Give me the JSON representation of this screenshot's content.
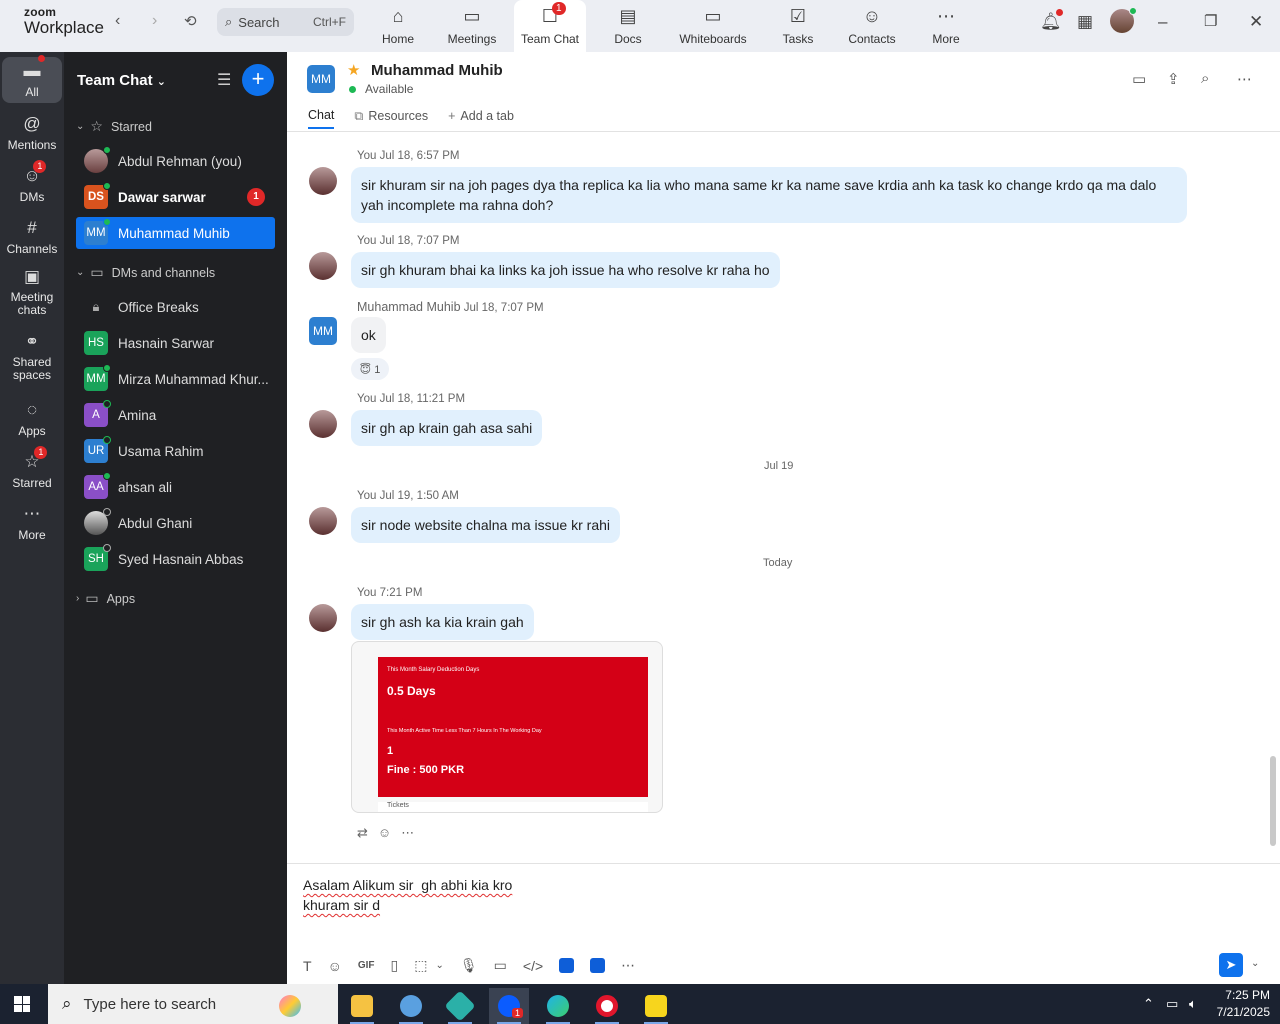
{
  "app": {
    "logo_line1": "zoom",
    "logo_line2": "Workplace"
  },
  "search": {
    "label": "Search",
    "shortcut": "Ctrl+F"
  },
  "nav": [
    {
      "label": "Home",
      "icon": "home-icon"
    },
    {
      "label": "Meetings",
      "icon": "video-icon"
    },
    {
      "label": "Team Chat",
      "icon": "chat-icon",
      "badge": "1",
      "active": true
    },
    {
      "label": "Docs",
      "icon": "doc-icon"
    },
    {
      "label": "Whiteboards",
      "icon": "whiteboard-icon"
    },
    {
      "label": "Tasks",
      "icon": "tasks-icon"
    },
    {
      "label": "Contacts",
      "icon": "contacts-icon"
    },
    {
      "label": "More",
      "icon": "more-icon"
    }
  ],
  "rail": [
    {
      "label": "All",
      "icon": "chat-bubble-icon",
      "active": true
    },
    {
      "label": "Mentions",
      "icon": "at-icon"
    },
    {
      "label": "DMs",
      "icon": "people-icon",
      "badge": "1"
    },
    {
      "label": "Channels",
      "icon": "hash-icon"
    },
    {
      "label": "Meeting chats",
      "icon": "calendar-icon"
    },
    {
      "label": "Shared spaces",
      "icon": "share-icon"
    },
    {
      "label": "Apps",
      "icon": "apps-icon"
    },
    {
      "label": "Starred",
      "icon": "star-icon",
      "badge": "1"
    },
    {
      "label": "More",
      "icon": "more-icon"
    }
  ],
  "sidebar": {
    "title": "Team Chat",
    "starred_label": "Starred",
    "dms_label": "DMs and channels",
    "apps_label": "Apps",
    "starred": [
      {
        "name": "Abdul Rehman (you)",
        "initials": "",
        "color": "photo"
      },
      {
        "name": "Dawar sarwar",
        "initials": "DS",
        "color": "#d9531e",
        "badge": "1",
        "bold": true
      },
      {
        "name": "Muhammad Muhib",
        "initials": "MM",
        "color": "#2d7fd0",
        "selected": true
      }
    ],
    "dms": [
      {
        "name": "Office Breaks",
        "initials": "",
        "color": "lock"
      },
      {
        "name": "Hasnain Sarwar",
        "initials": "HS",
        "color": "#1aa35a"
      },
      {
        "name": "Mirza Muhammad Khur...",
        "initials": "MM",
        "color": "#1aa35a"
      },
      {
        "name": "Amina",
        "initials": "A",
        "color": "#8a4fc7"
      },
      {
        "name": "Usama Rahim",
        "initials": "UR",
        "color": "#2d7fd0"
      },
      {
        "name": "ahsan ali",
        "initials": "AA",
        "color": "#8a4fc7"
      },
      {
        "name": "Abdul Ghani",
        "initials": "",
        "color": "photo2"
      },
      {
        "name": "Syed Hasnain Abbas",
        "initials": "SH",
        "color": "#1aa35a"
      }
    ]
  },
  "chat": {
    "contact_initials": "MM",
    "contact_name": "Muhammad Muhib",
    "status": "Available",
    "tabs": {
      "chat": "Chat",
      "resources": "Resources",
      "add": "Add a tab"
    }
  },
  "messages": {
    "m1_meta": "You Jul 18, 6:57 PM",
    "m1_text": "sir  khuram sir na joh pages dya tha  replica ka lia who mana same kr ka name save krdia anh ka task ko change krdo qa ma dalo yah incomplete ma rahna doh?",
    "m2_meta": "You Jul 18, 7:07 PM",
    "m2_text": "sir gh khuram bhai ka links ka joh issue ha who resolve kr raha ho",
    "m3_name": "Muhammad Muhib",
    "m3_time": "Jul 18, 7:07 PM",
    "m3_text": "ok",
    "m3_reaction": "😇 1",
    "m4_meta": "You Jul 18, 11:21 PM",
    "m4_text": "sir gh ap krain gah asa sahi",
    "sep1": "Jul 19",
    "m5_meta": "You Jul 19, 1:50 AM",
    "m5_text": "sir node website chalna ma issue kr rahi",
    "sep2": "Today",
    "m6_meta": "You 7:21 PM",
    "m6_text": "sir gh ash ka kia krain gah",
    "attachment": {
      "line1": "This Month Salary Deduction Days",
      "line2": "0.5 Days",
      "line3": "This Month Active Time Less Than 7 Hours In The Working Day",
      "line4": "1",
      "line5": "Fine : 500 PKR",
      "footer": "Tickets"
    }
  },
  "composer": {
    "text": "Asalam Alikum sir  gh abhi kia kro\nkhuram sir d"
  },
  "taskbar": {
    "search_placeholder": "Type here to search",
    "time": "7:25 PM",
    "date": "7/21/2025",
    "zoom_badge": "1"
  }
}
